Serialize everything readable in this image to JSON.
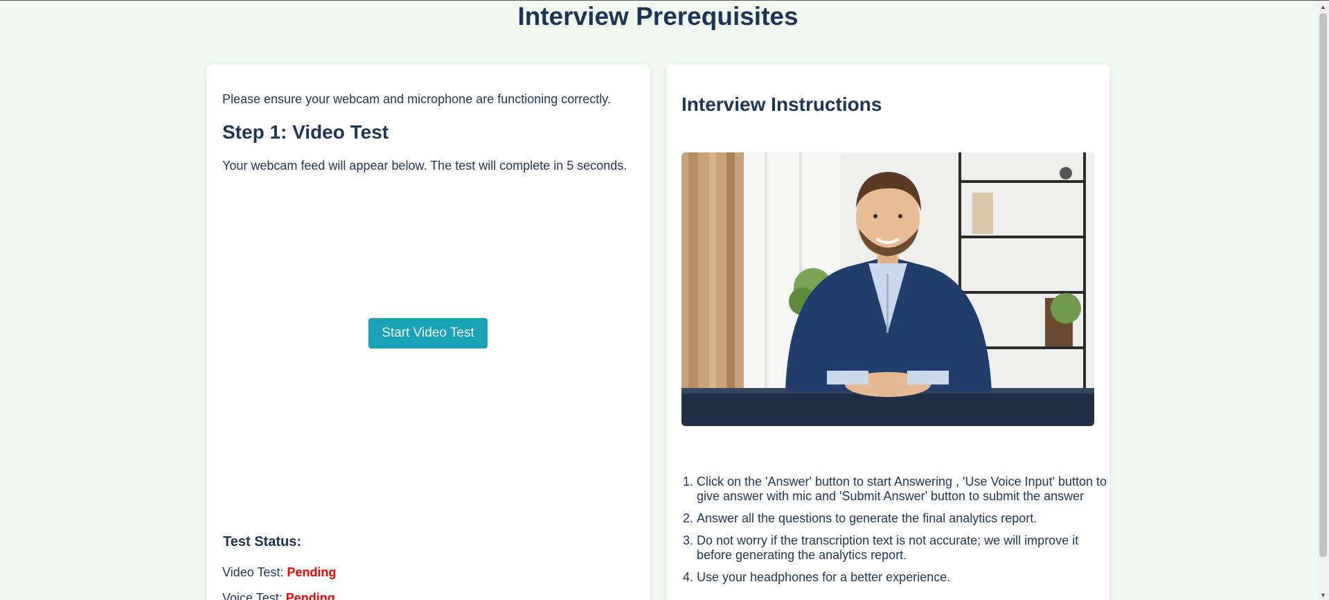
{
  "page": {
    "title": "Interview Prerequisites"
  },
  "left": {
    "intro": "Please ensure your webcam and microphone are functioning correctly.",
    "step_title": "Step 1: Video Test",
    "step_desc": "Your webcam feed will appear below. The test will complete in 5 seconds.",
    "start_button": "Start Video Test",
    "status_title": "Test Status:",
    "video_label": "Video Test:",
    "video_status": "Pending",
    "voice_label": "Voice Test:",
    "voice_status": "Pending"
  },
  "right": {
    "title": "Interview Instructions",
    "photo_icon": "interviewer-photo",
    "instructions": [
      "Click on the 'Answer' button to start Answering , 'Use Voice Input' button to give answer with mic and 'Submit Answer' button to submit the answer",
      "Answer all the questions to generate the final analytics report.",
      "Do not worry if the transcription text is not accurate; we will improve it before generating the analytics report.",
      "Use your headphones for a better experience."
    ]
  },
  "colors": {
    "background": "#f0f9f0",
    "heading": "#1c3557",
    "button": "#17a2b8",
    "pending": "#ff0000"
  }
}
